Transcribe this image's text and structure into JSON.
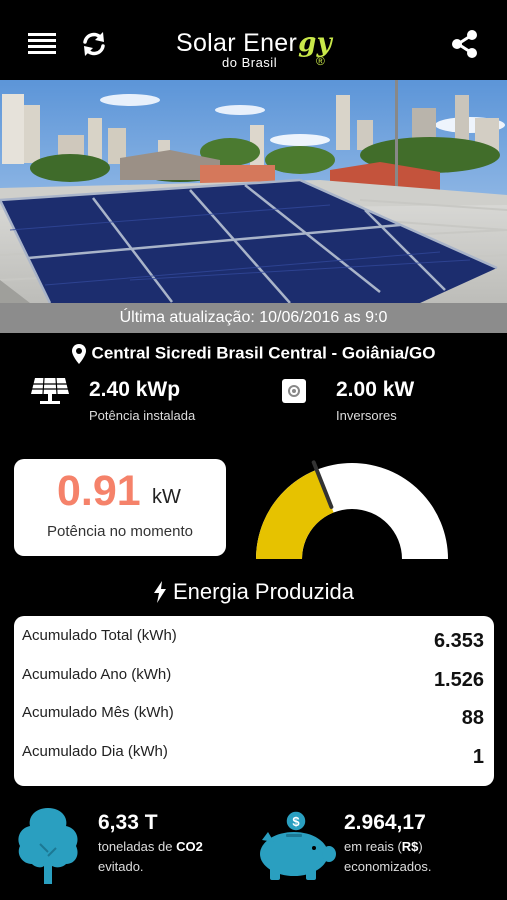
{
  "header": {
    "logo_main": "Solar Ener",
    "logo_script": "gy",
    "logo_sub": "do Brasil",
    "logo_reg": "®",
    "icons": [
      "menu-icon",
      "refresh-icon",
      "share-icon"
    ]
  },
  "photo": {
    "description_icon": "solar-panels-photo"
  },
  "update": {
    "text": "Última atualização: 10/06/2016 as 9:0"
  },
  "location": {
    "name": "Central Sicredi Brasil Central - Goiânia/GO"
  },
  "stats": {
    "installed": {
      "value": "2.40 kWp",
      "label": "Potência instalada"
    },
    "inverters": {
      "value": "2.00 kW",
      "label": "Inversores"
    }
  },
  "power": {
    "value": "0.91",
    "unit": "kW",
    "label": "Potência no momento",
    "gauge_fraction": 0.38,
    "gauge_fill_color": "#e6c200",
    "gauge_track_color": "#ffffff"
  },
  "energy": {
    "title": "Energia Produzida",
    "rows": [
      {
        "label": "Acumulado Total (kWh)",
        "value": "6.353"
      },
      {
        "label": "Acumulado Ano (kWh)",
        "value": "1.526"
      },
      {
        "label": "Acumulado Mês (kWh)",
        "value": "88"
      },
      {
        "label": "Acumulado Dia (kWh)",
        "value": "1"
      }
    ]
  },
  "co2": {
    "value": "6,33 T",
    "label_prefix": "toneladas de ",
    "label_bold": "CO2",
    "label_suffix": "evitado."
  },
  "savings": {
    "value": "2.964,17",
    "label_prefix": "em reais (",
    "label_bold": "R$",
    "label_mid": ")",
    "label_suffix": "economizados."
  },
  "colors": {
    "accent_teal": "#2a9fc0",
    "power_red": "#f5826a",
    "logo_green": "#c9e84a"
  }
}
